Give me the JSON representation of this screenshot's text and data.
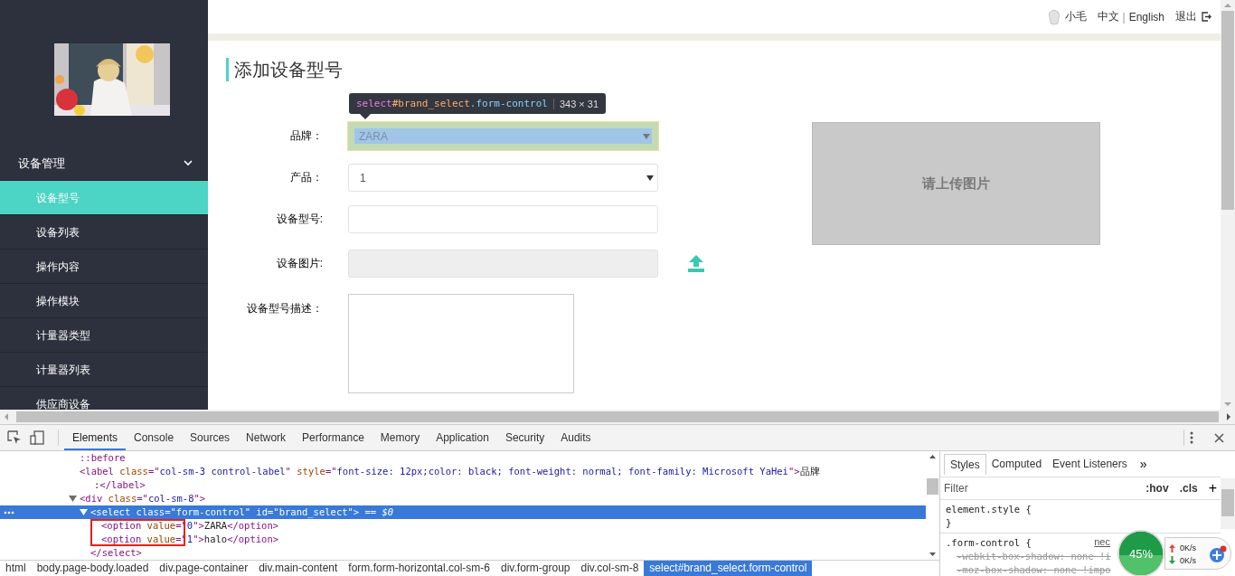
{
  "header": {
    "user": "小毛",
    "languages": [
      "中文",
      "English"
    ],
    "separator": "|",
    "logout": "退出"
  },
  "sidebar": {
    "menu": [
      {
        "label": "设备管理",
        "expanded": true,
        "children": [
          {
            "label": "设备型号",
            "selected": true
          },
          {
            "label": "设备列表",
            "selected": false
          },
          {
            "label": "操作内容",
            "selected": false
          },
          {
            "label": "操作模块",
            "selected": false
          },
          {
            "label": "计量器类型",
            "selected": false
          },
          {
            "label": "计量器列表",
            "selected": false
          },
          {
            "label": "供应商设备",
            "selected": false
          }
        ]
      }
    ]
  },
  "page": {
    "title": "添加设备型号",
    "fields": [
      {
        "label": "品牌：",
        "kind": "select",
        "value": "ZARA",
        "inspected": true
      },
      {
        "label": "产品：",
        "kind": "select",
        "value": "1",
        "inspected": false
      },
      {
        "label": "设备型号:",
        "kind": "text"
      },
      {
        "label": "设备图片:",
        "kind": "upload",
        "disabled": true
      },
      {
        "label": "设备型号描述：",
        "kind": "textarea"
      }
    ],
    "preview": "请上传图片"
  },
  "inspect_tooltip": {
    "tag": "select",
    "id": "#brand_select",
    "class": ".form-control",
    "size": "343 × 31"
  },
  "devtools": {
    "tabs": [
      {
        "label": "Elements",
        "selected": true
      },
      {
        "label": "Console",
        "selected": false
      },
      {
        "label": "Sources",
        "selected": false
      },
      {
        "label": "Network",
        "selected": false
      },
      {
        "label": "Performance",
        "selected": false
      },
      {
        "label": "Memory",
        "selected": false
      },
      {
        "label": "Application",
        "selected": false
      },
      {
        "label": "Security",
        "selected": false
      },
      {
        "label": "Audits",
        "selected": false
      }
    ],
    "dom": [
      {
        "lines": [
          [
            {
              "kind": "pseudo",
              "text": "::before"
            }
          ]
        ]
      },
      {
        "lines": [
          [
            {
              "kind": "tag",
              "text": "<label "
            },
            {
              "kind": "attr",
              "text": "class"
            },
            {
              "kind": "tag",
              "text": "=\""
            },
            {
              "kind": "value",
              "text": "col-sm-3 control-label"
            },
            {
              "kind": "tag",
              "text": "\" "
            },
            {
              "kind": "attr",
              "text": "style"
            },
            {
              "kind": "tag",
              "text": "=\""
            },
            {
              "kind": "value",
              "text": "font-size: 12px;color: black; font-weight: normal; font-family: Microsoft YaHei"
            },
            {
              "kind": "tag",
              "text": "\">"
            },
            {
              "kind": "text",
              "text": "品牌"
            }
          ],
          [
            {
              "kind": "text",
              "text": ":"
            },
            {
              "kind": "tag",
              "text": "</label>"
            }
          ]
        ]
      },
      {
        "expanded": true,
        "lines": [
          [
            {
              "kind": "tag",
              "text": "<div "
            },
            {
              "kind": "attr",
              "text": "class"
            },
            {
              "kind": "tag",
              "text": "=\""
            },
            {
              "kind": "value",
              "text": "col-sm-8"
            },
            {
              "kind": "tag",
              "text": "\">"
            }
          ]
        ],
        "children": [
          {
            "expanded": true,
            "selected": true,
            "lines": [
              [
                {
                  "kind": "tag",
                  "text": "<select "
                },
                {
                  "kind": "attr",
                  "text": "class"
                },
                {
                  "kind": "tag",
                  "text": "=\""
                },
                {
                  "kind": "value",
                  "text": "form-control"
                },
                {
                  "kind": "tag",
                  "text": "\" "
                },
                {
                  "kind": "attr",
                  "text": "id"
                },
                {
                  "kind": "tag",
                  "text": "=\""
                },
                {
                  "kind": "value",
                  "text": "brand_select"
                },
                {
                  "kind": "tag",
                  "text": "\">"
                },
                {
                  "kind": "comment",
                  "text": " == $0"
                }
              ]
            ],
            "children": [
              {
                "boxed": true,
                "lines": [
                  [
                    {
                      "kind": "tag",
                      "text": "<option "
                    },
                    {
                      "kind": "attr",
                      "text": "value"
                    },
                    {
                      "kind": "tag",
                      "text": "=\""
                    },
                    {
                      "kind": "value",
                      "text": "0"
                    },
                    {
                      "kind": "tag",
                      "text": "\">"
                    },
                    {
                      "kind": "text",
                      "text": "ZARA"
                    },
                    {
                      "kind": "tag",
                      "text": "</option>"
                    }
                  ]
                ]
              },
              {
                "boxed": true,
                "lines": [
                  [
                    {
                      "kind": "tag",
                      "text": "<option "
                    },
                    {
                      "kind": "attr",
                      "text": "value"
                    },
                    {
                      "kind": "tag",
                      "text": "=\""
                    },
                    {
                      "kind": "value",
                      "text": "1"
                    },
                    {
                      "kind": "tag",
                      "text": "\">"
                    },
                    {
                      "kind": "text",
                      "text": "halo"
                    },
                    {
                      "kind": "tag",
                      "text": "</option>"
                    }
                  ]
                ]
              }
            ],
            "close": [
              {
                "kind": "tag",
                "text": "</select>"
              }
            ]
          }
        ]
      }
    ],
    "styles": {
      "tabs": [
        {
          "label": "Styles",
          "selected": true
        },
        {
          "label": "Computed",
          "selected": false
        },
        {
          "label": "Event Listeners",
          "selected": false
        }
      ],
      "more": "»",
      "filter_placeholder": "Filter",
      "hov": ":hov",
      "cls": ".cls",
      "add": "+",
      "rules": [
        {
          "selector": "element.style {",
          "close": "}"
        },
        {
          "selector": ".form-control {",
          "source": "nec",
          "declarations": [
            {
              "text": "-webkit-box-shadow: none !i",
              "struck": true
            },
            {
              "text": "-moz-box-shadow: none !impo",
              "struck": true
            }
          ]
        }
      ]
    },
    "breadcrumbs": [
      {
        "label": "html",
        "selected": false
      },
      {
        "label": "body.page-body.loaded",
        "selected": false
      },
      {
        "label": "div.page-container",
        "selected": false
      },
      {
        "label": "div.main-content",
        "selected": false
      },
      {
        "label": "form.form-horizontal.col-sm-6",
        "selected": false
      },
      {
        "label": "div.form-group",
        "selected": false
      },
      {
        "label": "div.col-sm-8",
        "selected": false
      },
      {
        "label": "select#brand_select.form-control",
        "selected": true
      }
    ]
  },
  "speed_widget": {
    "percent": "45%",
    "level": 0.45,
    "upload": "0K/s",
    "download": "0K/s"
  }
}
